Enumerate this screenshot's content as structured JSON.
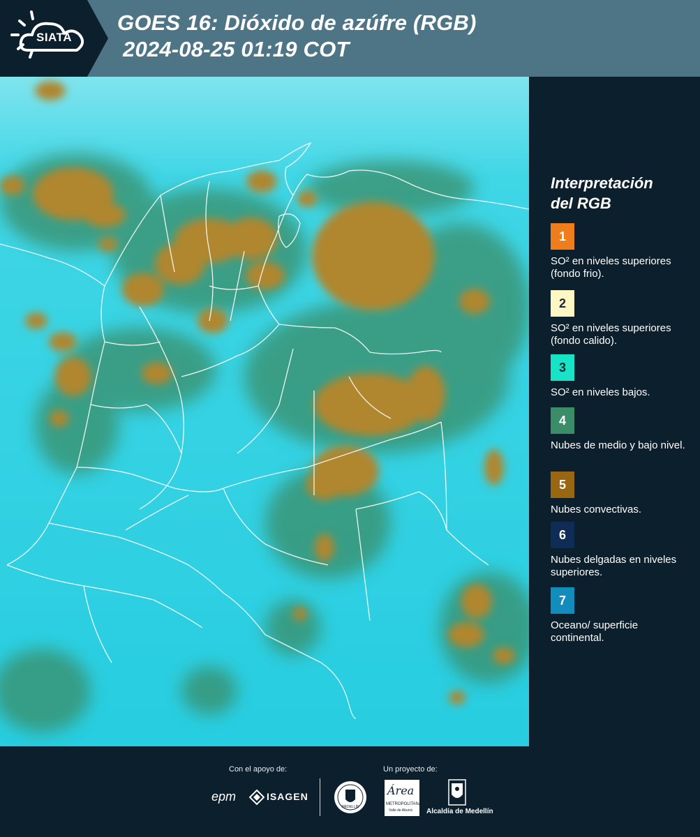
{
  "header": {
    "logo_text": "SIATA",
    "title_line1": "GOES 16: Dióxido de azúfre (RGB)",
    "title_line2": "2024-08-25 01:19 COT"
  },
  "legend": {
    "title_line1": "Interpretación",
    "title_line2": "del RGB",
    "items": [
      {
        "number": "1",
        "color": "#f07d1c",
        "text_color": "#ffffff",
        "label": "SO² en niveles superiores (fondo frio)."
      },
      {
        "number": "2",
        "color": "#fdf7c5",
        "text_color": "#1f2a33",
        "label": "SO² en niveles superiores (fondo calido)."
      },
      {
        "number": "3",
        "color": "#19e3c6",
        "text_color": "#1f2a33",
        "label": "SO² en niveles bajos."
      },
      {
        "number": "4",
        "color": "#3a8d68",
        "text_color": "#ffffff",
        "label": "Nubes de medio y bajo nivel."
      },
      {
        "number": "5",
        "color": "#996712",
        "text_color": "#ffffff",
        "label": "Nubes convectivas."
      },
      {
        "number": "6",
        "color": "#0f2c57",
        "text_color": "#ffffff",
        "label": "Nubes delgadas en niveles superiores."
      },
      {
        "number": "7",
        "color": "#128bbd",
        "text_color": "#ffffff",
        "label": "Oceano/ superficie continental."
      }
    ]
  },
  "footer": {
    "support_label": "Con el apoyo de:",
    "project_label": "Un proyecto de:",
    "sponsor1": "epm",
    "sponsor2": "ISAGEN",
    "partner1": "Área",
    "partner1_sub": "METROPOLITANA",
    "partner1_sub2": "Valle de Aburrá",
    "partner2": "Alcaldía de Medellín",
    "seal_text": "MEDELLÍN"
  },
  "map": {
    "background_color": "#2ad0e0",
    "convective_color": "#b0862f",
    "mid_low_cloud_color": "#3a8d68",
    "border_color": "#ffffff"
  }
}
